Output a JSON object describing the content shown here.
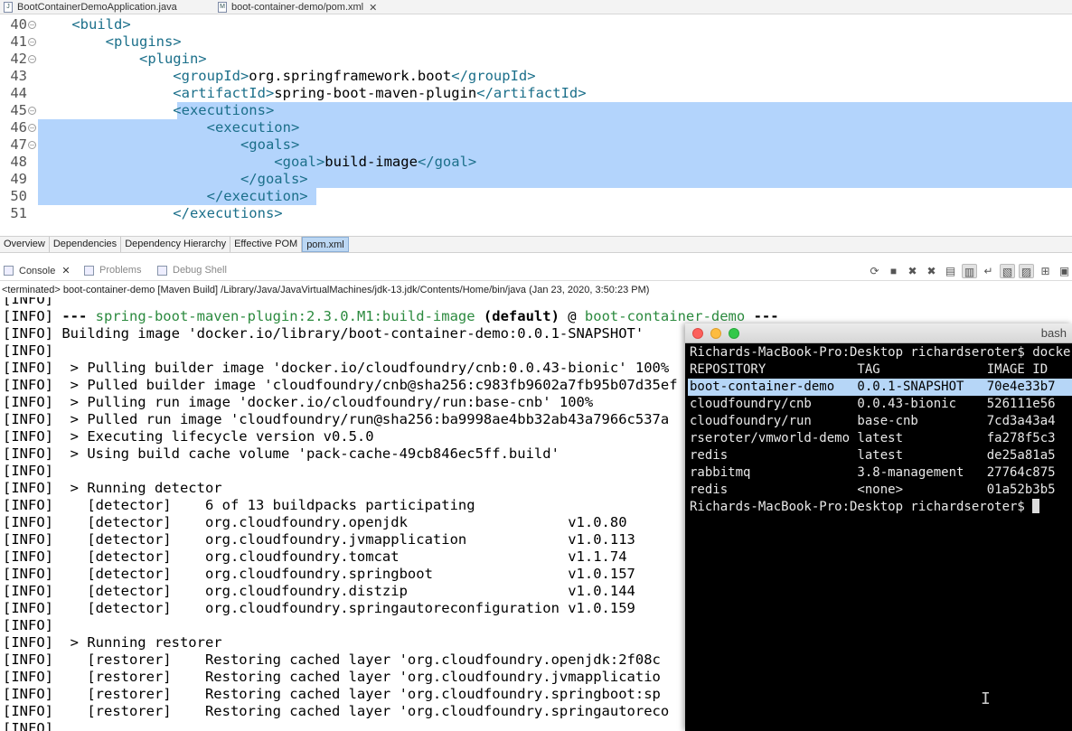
{
  "editor_tabs": [
    {
      "label": "BootContainerDemoApplication.java",
      "icon": "java-file-icon"
    },
    {
      "label": "boot-container-demo/pom.xml",
      "icon": "xml-file-icon"
    }
  ],
  "editor_lines": [
    {
      "num": "40",
      "fold": true,
      "parts": [
        [
          "tag",
          "    <build>"
        ]
      ]
    },
    {
      "num": "41",
      "fold": true,
      "parts": [
        [
          "tag",
          "        <plugins>"
        ]
      ]
    },
    {
      "num": "42",
      "fold": true,
      "parts": [
        [
          "tag",
          "            <plugin>"
        ]
      ]
    },
    {
      "num": "43",
      "fold": false,
      "parts": [
        [
          "tag",
          "                <groupId>"
        ],
        [
          "txt",
          "org.springframework.boot"
        ],
        [
          "tag",
          "</groupId>"
        ]
      ]
    },
    {
      "num": "44",
      "fold": false,
      "parts": [
        [
          "tag",
          "                <artifactId>"
        ],
        [
          "txt",
          "spring-boot-maven-plugin"
        ],
        [
          "tag",
          "</artifactId>"
        ]
      ]
    },
    {
      "num": "45",
      "fold": true,
      "parts": [
        [
          "tag",
          "                <executions>"
        ]
      ]
    },
    {
      "num": "46",
      "fold": true,
      "parts": [
        [
          "tag",
          "                    <execution>"
        ]
      ]
    },
    {
      "num": "47",
      "fold": true,
      "parts": [
        [
          "tag",
          "                        <goals>"
        ]
      ]
    },
    {
      "num": "48",
      "fold": false,
      "parts": [
        [
          "tag",
          "                            <goal>"
        ],
        [
          "txt",
          "build-image"
        ],
        [
          "tag",
          "</goal>"
        ]
      ]
    },
    {
      "num": "49",
      "fold": false,
      "parts": [
        [
          "tag",
          "                        </goals>"
        ]
      ]
    },
    {
      "num": "50",
      "fold": false,
      "parts": [
        [
          "tag",
          "                    </execution>"
        ]
      ]
    },
    {
      "num": "51",
      "fold": false,
      "parts": [
        [
          "tag",
          "                </executions>"
        ]
      ]
    }
  ],
  "pom_tabs": [
    "Overview",
    "Dependencies",
    "Dependency Hierarchy",
    "Effective POM",
    "pom.xml"
  ],
  "pom_active_tab": "pom.xml",
  "view_tabs": [
    {
      "label": "Console",
      "icon": "console-icon",
      "active": true
    },
    {
      "label": "Problems",
      "icon": "problems-icon",
      "active": false
    },
    {
      "label": "Debug Shell",
      "icon": "debug-shell-icon",
      "active": false
    }
  ],
  "console_path": "<terminated> boot-container-demo [Maven Build] /Library/Java/JavaVirtualMachines/jdk-13.jdk/Contents/Home/bin/java (Jan 23, 2020, 3:50:23 PM)",
  "console_lines": [
    {
      "parts": [
        [
          "n",
          "[INFO]"
        ]
      ]
    },
    {
      "parts": [
        [
          "n",
          "[INFO] "
        ],
        [
          "b",
          "--- "
        ],
        [
          "g",
          "spring-boot-maven-plugin:2.3.0.M1:build-image"
        ],
        [
          "b",
          " (default)"
        ],
        [
          "n",
          " @ "
        ],
        [
          "g",
          "boot-container-demo"
        ],
        [
          "b",
          " ---"
        ]
      ]
    },
    {
      "parts": [
        [
          "n",
          "[INFO] Building image 'docker.io/library/boot-container-demo:0.0.1-SNAPSHOT'"
        ]
      ]
    },
    {
      "parts": [
        [
          "n",
          "[INFO]"
        ]
      ]
    },
    {
      "parts": [
        [
          "n",
          "[INFO]  > Pulling builder image 'docker.io/cloudfoundry/cnb:0.0.43-bionic' 100%"
        ]
      ]
    },
    {
      "parts": [
        [
          "n",
          "[INFO]  > Pulled builder image 'cloudfoundry/cnb@sha256:c983fb9602a7fb95b07d35ef"
        ]
      ]
    },
    {
      "parts": [
        [
          "n",
          "[INFO]  > Pulling run image 'docker.io/cloudfoundry/run:base-cnb' 100%"
        ]
      ]
    },
    {
      "parts": [
        [
          "n",
          "[INFO]  > Pulled run image 'cloudfoundry/run@sha256:ba9998ae4bb32ab43a7966c537a"
        ]
      ]
    },
    {
      "parts": [
        [
          "n",
          "[INFO]  > Executing lifecycle version v0.5.0"
        ]
      ]
    },
    {
      "parts": [
        [
          "n",
          "[INFO]  > Using build cache volume 'pack-cache-49cb846ec5ff.build'"
        ]
      ]
    },
    {
      "parts": [
        [
          "n",
          "[INFO]"
        ]
      ]
    },
    {
      "parts": [
        [
          "n",
          "[INFO]  > Running detector"
        ]
      ]
    },
    {
      "parts": [
        [
          "n",
          "[INFO]    [detector]    6 of 13 buildpacks participating"
        ]
      ]
    },
    {
      "parts": [
        [
          "n",
          "[INFO]    [detector]    org.cloudfoundry.openjdk                   v1.0.80"
        ]
      ]
    },
    {
      "parts": [
        [
          "n",
          "[INFO]    [detector]    org.cloudfoundry.jvmapplication            v1.0.113"
        ]
      ]
    },
    {
      "parts": [
        [
          "n",
          "[INFO]    [detector]    org.cloudfoundry.tomcat                    v1.1.74"
        ]
      ]
    },
    {
      "parts": [
        [
          "n",
          "[INFO]    [detector]    org.cloudfoundry.springboot                v1.0.157"
        ]
      ]
    },
    {
      "parts": [
        [
          "n",
          "[INFO]    [detector]    org.cloudfoundry.distzip                   v1.0.144"
        ]
      ]
    },
    {
      "parts": [
        [
          "n",
          "[INFO]    [detector]    org.cloudfoundry.springautoreconfiguration v1.0.159"
        ]
      ]
    },
    {
      "parts": [
        [
          "n",
          "[INFO]"
        ]
      ]
    },
    {
      "parts": [
        [
          "n",
          "[INFO]  > Running restorer"
        ]
      ]
    },
    {
      "parts": [
        [
          "n",
          "[INFO]    [restorer]    Restoring cached layer 'org.cloudfoundry.openjdk:2f08c"
        ]
      ]
    },
    {
      "parts": [
        [
          "n",
          "[INFO]    [restorer]    Restoring cached layer 'org.cloudfoundry.jvmapplicatio"
        ]
      ]
    },
    {
      "parts": [
        [
          "n",
          "[INFO]    [restorer]    Restoring cached layer 'org.cloudfoundry.springboot:sp"
        ]
      ]
    },
    {
      "parts": [
        [
          "n",
          "[INFO]    [restorer]    Restoring cached layer 'org.cloudfoundry.springautoreco"
        ]
      ]
    },
    {
      "parts": [
        [
          "n",
          "[INFO]"
        ]
      ]
    }
  ],
  "terminal": {
    "title": "bash",
    "lines": [
      "Richards-MacBook-Pro:Desktop richardseroter$ docker i",
      "REPOSITORY            TAG              IMAGE ID",
      "boot-container-demo   0.0.1-SNAPSHOT   70e4e33b7",
      "cloudfoundry/cnb      0.0.43-bionic    526111e56",
      "cloudfoundry/run      base-cnb         7cd3a43a4",
      "rseroter/vmworld-demo latest           fa278f5c3",
      "redis                 latest           de25a81a5",
      "rabbitmq              3.8-management   27764c875",
      "redis                 <none>           01a52b3b5",
      "Richards-MacBook-Pro:Desktop richardseroter$ "
    ],
    "selected_line": 2
  },
  "colors": {
    "tag": "#1b6f8a",
    "selection": "#b3d4fc",
    "plugin_green": "#2b8a3e",
    "terminal_bg": "#000000"
  }
}
